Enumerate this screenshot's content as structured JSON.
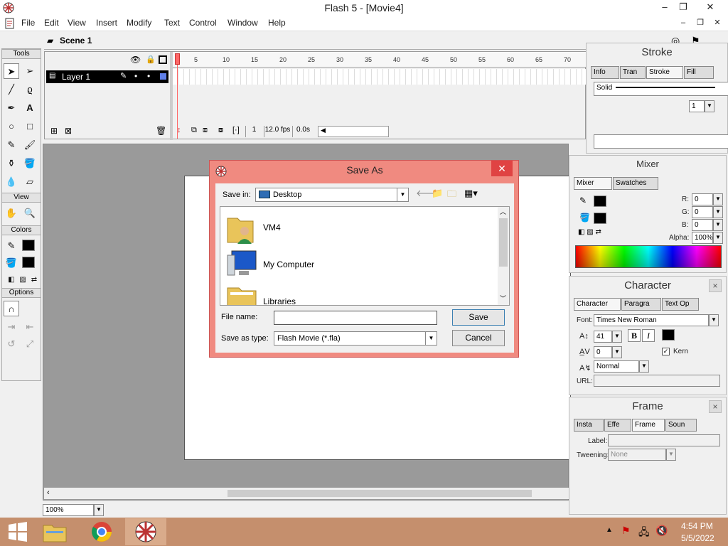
{
  "window": {
    "title": "Flash 5 - [Movie4]",
    "min": "–",
    "max": "❐",
    "close": "✕"
  },
  "menus": [
    "File",
    "Edit",
    "View",
    "Insert",
    "Modify",
    "Text",
    "Control",
    "Window",
    "Help"
  ],
  "scene": {
    "label": "Scene 1"
  },
  "tools_panel": {
    "title": "Tools",
    "view": "View",
    "colors": "Colors",
    "options": "Options"
  },
  "timeline": {
    "layer_name": "Layer 1",
    "ruler": [
      "5",
      "10",
      "15",
      "20",
      "25",
      "30",
      "35",
      "40",
      "45",
      "50",
      "55",
      "60",
      "65",
      "70"
    ],
    "frame": "1",
    "fps": "12.0 fps",
    "time": "0.0s"
  },
  "zoom": {
    "value": "100%"
  },
  "stroke_panel": {
    "title": "Stroke",
    "tabs": [
      "Info",
      "Tran",
      "Stroke",
      "Fill"
    ],
    "style": "Solid",
    "weight": "1"
  },
  "mixer_panel": {
    "title": "Mixer",
    "tabs": [
      "Mixer",
      "Swatches"
    ],
    "r_label": "R:",
    "g_label": "G:",
    "b_label": "B:",
    "alpha_label": "Alpha:",
    "r": "0",
    "g": "0",
    "b": "0",
    "alpha": "100%"
  },
  "character_panel": {
    "title": "Character",
    "tabs": [
      "Character",
      "Paragra",
      "Text Op"
    ],
    "font_label": "Font:",
    "font": "Times New Roman",
    "size": "41",
    "tracking": "0",
    "bold": "B",
    "italic": "I",
    "kern": "Kern",
    "baseline": "Normal",
    "url_label": "URL:"
  },
  "frame_panel": {
    "title": "Frame",
    "tabs": [
      "Insta",
      "Effe",
      "Frame",
      "Soun"
    ],
    "label_label": "Label:",
    "tweening_label": "Tweening:",
    "tweening": "None"
  },
  "dialog": {
    "title": "Save As",
    "save_in_label": "Save in:",
    "save_in_value": "Desktop",
    "items": [
      {
        "label": "VM4",
        "icon": "user-folder-icon"
      },
      {
        "label": "My Computer",
        "icon": "computer-icon"
      },
      {
        "label": "Libraries",
        "icon": "libraries-folder-icon"
      }
    ],
    "file_name_label": "File name:",
    "file_name_value": "",
    "save_type_label": "Save as type:",
    "save_type_value": "Flash Movie (*.fla)",
    "save_button": "Save",
    "cancel_button": "Cancel"
  },
  "taskbar": {
    "time": "4:54 PM",
    "date": "5/5/2022"
  },
  "colors": {
    "dialog_border": "#f08a80",
    "taskbar": "#c58f6d",
    "close_red": "#e04343",
    "stage_bg": "#9a9a9a"
  }
}
